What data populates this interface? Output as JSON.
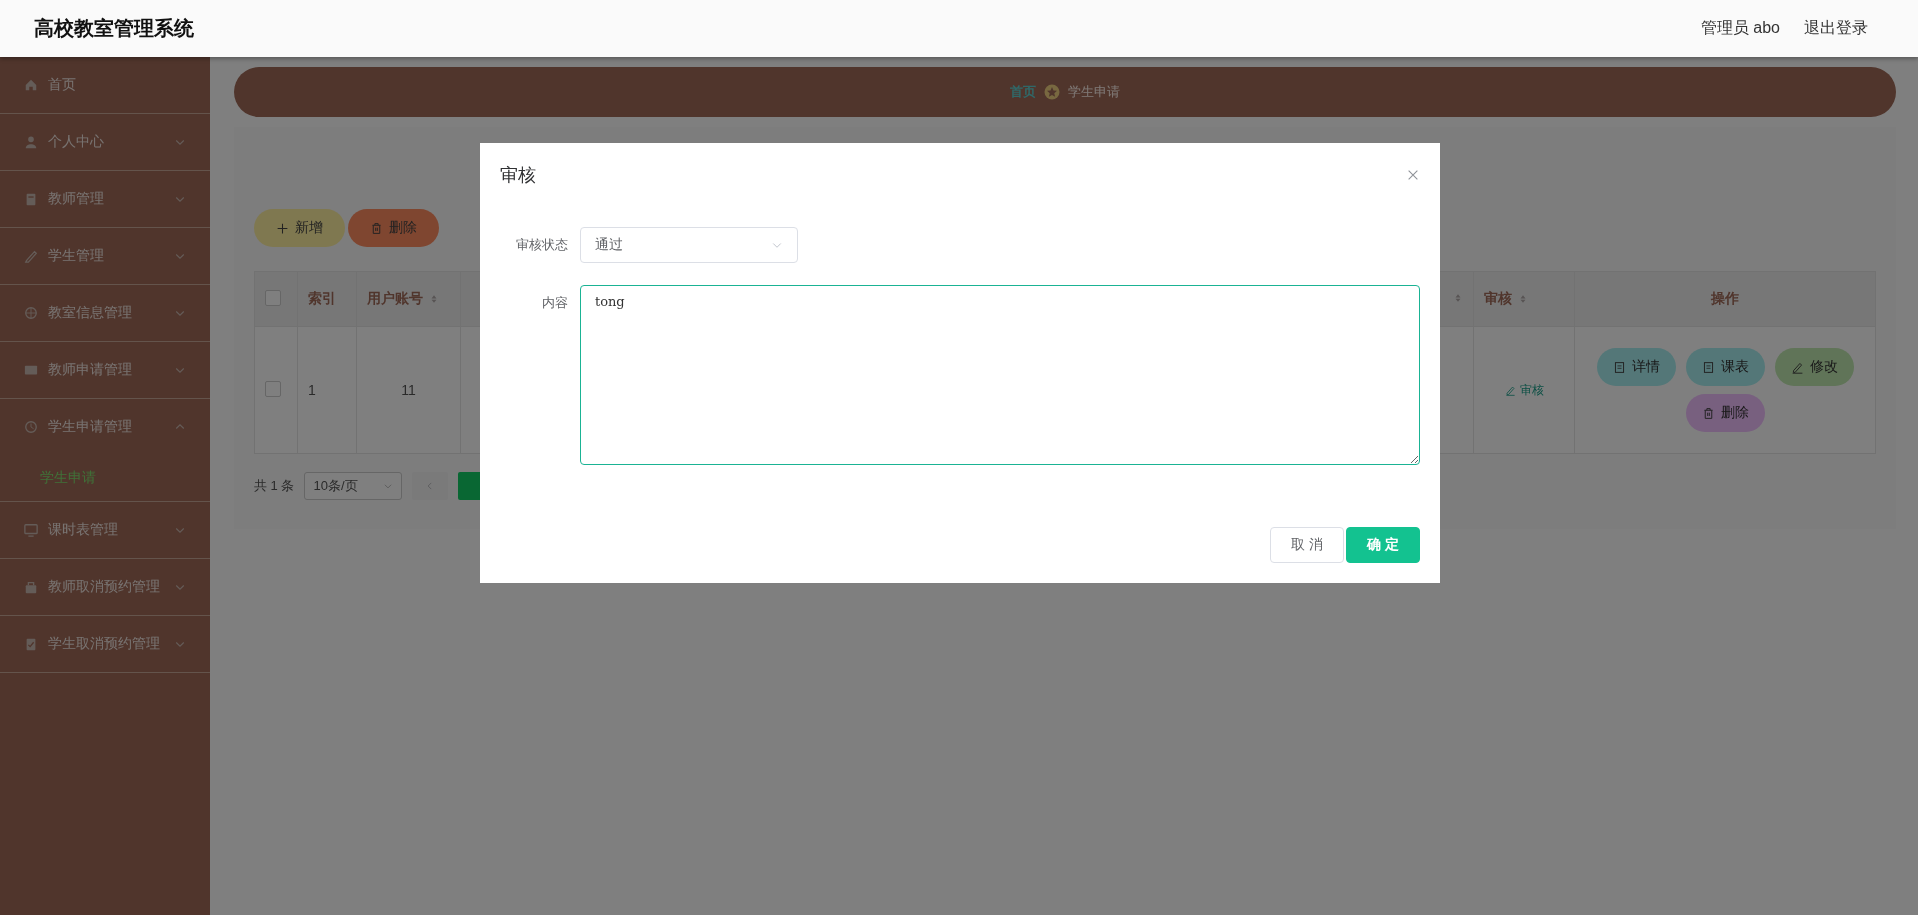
{
  "header": {
    "title": "高校教室管理系统",
    "user": "管理员 abo",
    "logout": "退出登录"
  },
  "sidebar": {
    "items": [
      {
        "label": "首页",
        "kind": "link"
      },
      {
        "label": "个人中心",
        "kind": "menu",
        "expanded": false
      },
      {
        "label": "教师管理",
        "kind": "menu",
        "expanded": false
      },
      {
        "label": "学生管理",
        "kind": "menu",
        "expanded": false
      },
      {
        "label": "教室信息管理",
        "kind": "menu",
        "expanded": false
      },
      {
        "label": "教师申请管理",
        "kind": "menu",
        "expanded": false
      },
      {
        "label": "学生申请管理",
        "kind": "menu",
        "expanded": true,
        "children": [
          {
            "label": "学生申请",
            "selected": true
          }
        ]
      },
      {
        "label": "课时表管理",
        "kind": "menu",
        "expanded": false
      },
      {
        "label": "教师取消预约管理",
        "kind": "menu",
        "expanded": false
      },
      {
        "label": "学生取消预约管理",
        "kind": "menu",
        "expanded": false
      }
    ]
  },
  "breadcrumb": [
    {
      "label": "首页",
      "current": false
    },
    {
      "label": "学生申请",
      "current": true
    }
  ],
  "toolbar": [
    {
      "label": "新增",
      "kind": "add"
    },
    {
      "label": "删除",
      "kind": "delete"
    }
  ],
  "table": {
    "columns": [
      {
        "kind": "checkbox",
        "checked": false
      },
      {
        "kind": "text",
        "label": "索引",
        "sortable": false
      },
      {
        "kind": "text",
        "label": "用户账号",
        "sortable": true
      },
      {
        "kind": "obscured",
        "sortable": true
      },
      {
        "kind": "text",
        "label": "审核",
        "sortable": true
      },
      {
        "kind": "text",
        "label": "操作",
        "sortable": false
      }
    ],
    "rows": [
      {
        "cells": [
          {
            "kind": "checkbox",
            "checked": false
          },
          {
            "kind": "text",
            "text": "1"
          },
          {
            "kind": "text",
            "text": "11"
          },
          {
            "kind": "obscured"
          },
          {
            "kind": "link",
            "text": "审核"
          },
          {
            "kind": "actions",
            "actions": [
              {
                "label": "详情",
                "kind": "detail"
              },
              {
                "label": "课表",
                "kind": "schedule"
              },
              {
                "label": "修改",
                "kind": "edit"
              },
              {
                "label": "删除",
                "kind": "delete"
              }
            ]
          }
        ]
      }
    ]
  },
  "pagination": {
    "total": "共 1 条",
    "page_size": "10条/页"
  },
  "dialog": {
    "title": "审核",
    "fields": [
      {
        "kind": "select",
        "label": "审核状态",
        "value": "通过"
      },
      {
        "kind": "textarea",
        "label": "内容",
        "value": "tong"
      }
    ],
    "buttons": [
      {
        "label": "取 消",
        "kind": "secondary"
      },
      {
        "label": "确 定",
        "kind": "primary"
      }
    ]
  }
}
